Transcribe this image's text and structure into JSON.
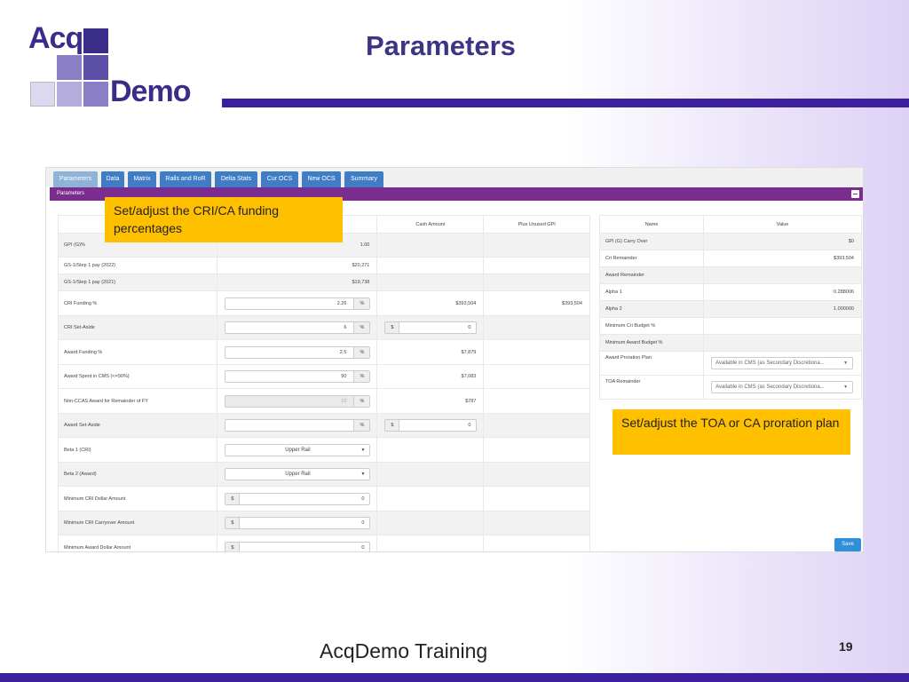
{
  "slide": {
    "title": "Parameters",
    "footer": "AcqDemo Training",
    "page_number": "19",
    "logo_top": "Acq",
    "logo_bottom": "Demo"
  },
  "tabs": [
    {
      "label": "Parameters",
      "active": true
    },
    {
      "label": "Data"
    },
    {
      "label": "Matrix"
    },
    {
      "label": "Rails and RoR"
    },
    {
      "label": "Delta Stats"
    },
    {
      "label": "Cur OCS"
    },
    {
      "label": "New OCS"
    },
    {
      "label": "Summary"
    }
  ],
  "panel": {
    "title": "Parameters"
  },
  "left_table": {
    "headers": [
      "",
      "",
      "Cash Amount",
      "Plus Unused GPI"
    ],
    "rows": [
      {
        "label": "GPI (G)%",
        "value": "1.00",
        "cash": "",
        "plus": ""
      },
      {
        "label": "GS-1/Step 1 pay (2022)",
        "value": "$20,271",
        "cash": "",
        "plus": ""
      },
      {
        "label": "GS-1/Step 1 pay (2021)",
        "value": "$19,738",
        "cash": "",
        "plus": ""
      },
      {
        "label": "CRI Funding %",
        "input": "2.26",
        "addon": "%",
        "cash": "$393,504",
        "plus": "$393,504"
      },
      {
        "label": "CRI Set-Aside",
        "input": "6",
        "addon": "%",
        "dollar_input": "0",
        "dollar_addon": "$"
      },
      {
        "label": "Award Funding %",
        "input": "2.5",
        "addon": "%",
        "cash": "$7,879"
      },
      {
        "label": "Award Spent in CMS (<=90%)",
        "input": "90",
        "addon": "%",
        "cash": "$7,083"
      },
      {
        "label": "Non-CCAS Award for Remainder of FY",
        "input": "10",
        "addon": "%",
        "cash": "$787"
      },
      {
        "label": "Award Set-Aside",
        "input": "",
        "addon": "%",
        "dollar_input": "0",
        "dollar_addon": "$"
      },
      {
        "label": "Beta 1 (CRI)",
        "select": "Upper Rail"
      },
      {
        "label": "Beta 2 (Award)",
        "select": "Upper Rail"
      },
      {
        "label": "Minimum CRI Dollar Amount",
        "dollar_wide": "0",
        "dollar_addon": "$"
      },
      {
        "label": "Minimum CRI Carryover Amount",
        "dollar_wide": "0",
        "dollar_addon": "$"
      },
      {
        "label": "Minimum Award Dollar Amount",
        "dollar_wide": "0",
        "dollar_addon": "$"
      }
    ]
  },
  "right_table": {
    "headers": [
      "Name",
      "Value"
    ],
    "rows": [
      {
        "label": "GPI (G) Carry Over",
        "value": "$0"
      },
      {
        "label": "Cri Remainder",
        "value": "$393,504"
      },
      {
        "label": "Award Remainder",
        "value": ""
      },
      {
        "label": "Alpha 1",
        "value": "0.288006"
      },
      {
        "label": "Alpha 2",
        "value": "1.000000"
      },
      {
        "label": "Minimum Cri Budget %",
        "value": ""
      },
      {
        "label": "Minimum Award Budget %",
        "value": ""
      },
      {
        "label": "Award Proration Plan",
        "select": "Available in CMS (as Secondary Discretiona..."
      },
      {
        "label": "TOA Remainder",
        "select": "Available in CMS (as Secondary Discretiona..."
      }
    ]
  },
  "save_label": "Save",
  "callouts": {
    "cri": "Set/adjust the CRI/CA funding percentages",
    "toa": "Set/adjust the TOA or CA proration plan"
  },
  "colors": {
    "brand_purple": "#3c1f9c",
    "panel_header": "#7a2d8f",
    "tab_blue": "#3f7ec6",
    "callout_yellow": "#ffc000"
  }
}
